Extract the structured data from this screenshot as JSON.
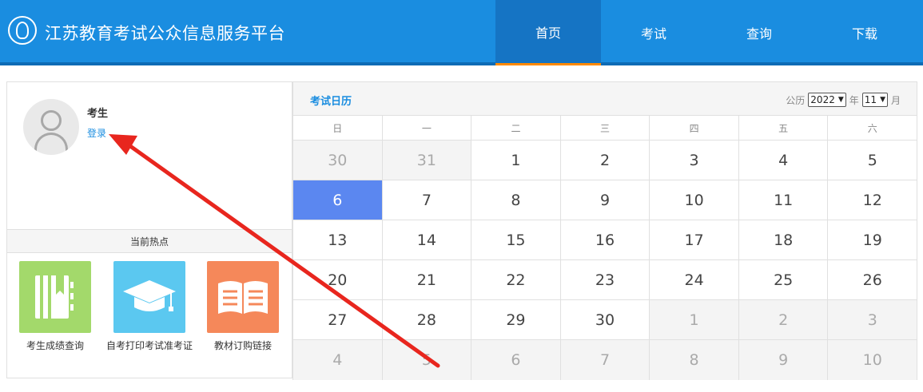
{
  "header": {
    "site_title": "江苏教育考试公众信息服务平台",
    "nav": [
      "首页",
      "考试",
      "查询",
      "下载"
    ],
    "active_nav": 0,
    "colors": {
      "primary": "#1a8de0",
      "active_tab_bg": "#1574c4",
      "active_tab_underline": "#ff8a00"
    }
  },
  "user": {
    "name": "考生",
    "login_label": "登录"
  },
  "hot": {
    "title": "当前热点",
    "items": [
      {
        "label": "考生成绩查询",
        "icon": "notebook-icon",
        "color": "#a3d96b"
      },
      {
        "label": "自考打印考试准考证",
        "icon": "graduation-cap-icon",
        "color": "#5bc8f0"
      },
      {
        "label": "教材订购链接",
        "icon": "open-book-icon",
        "color": "#f5885a"
      }
    ]
  },
  "calendar": {
    "title": "考试日历",
    "calendar_type": "公历",
    "year": "2022",
    "year_unit": "年",
    "month": "11",
    "month_unit": "月",
    "weekdays": [
      "日",
      "一",
      "二",
      "三",
      "四",
      "五",
      "六"
    ],
    "selected_day": "6",
    "selected_color": "#5b87f0",
    "weeks": [
      [
        {
          "d": "30",
          "other": true
        },
        {
          "d": "31",
          "other": true
        },
        {
          "d": "1"
        },
        {
          "d": "2"
        },
        {
          "d": "3"
        },
        {
          "d": "4"
        },
        {
          "d": "5"
        }
      ],
      [
        {
          "d": "6",
          "today": true
        },
        {
          "d": "7"
        },
        {
          "d": "8"
        },
        {
          "d": "9"
        },
        {
          "d": "10"
        },
        {
          "d": "11"
        },
        {
          "d": "12"
        }
      ],
      [
        {
          "d": "13"
        },
        {
          "d": "14"
        },
        {
          "d": "15"
        },
        {
          "d": "16"
        },
        {
          "d": "17"
        },
        {
          "d": "18"
        },
        {
          "d": "19"
        }
      ],
      [
        {
          "d": "20"
        },
        {
          "d": "21"
        },
        {
          "d": "22"
        },
        {
          "d": "23"
        },
        {
          "d": "24"
        },
        {
          "d": "25"
        },
        {
          "d": "26"
        }
      ],
      [
        {
          "d": "27"
        },
        {
          "d": "28"
        },
        {
          "d": "29"
        },
        {
          "d": "30"
        },
        {
          "d": "1",
          "other": true
        },
        {
          "d": "2",
          "other": true
        },
        {
          "d": "3",
          "other": true
        }
      ],
      [
        {
          "d": "4",
          "other": true
        },
        {
          "d": "5",
          "other": true
        },
        {
          "d": "6",
          "other": true
        },
        {
          "d": "7",
          "other": true
        },
        {
          "d": "8",
          "other": true
        },
        {
          "d": "9",
          "other": true
        },
        {
          "d": "10",
          "other": true
        }
      ]
    ]
  },
  "annotation": {
    "arrow_color": "#e8261e"
  }
}
